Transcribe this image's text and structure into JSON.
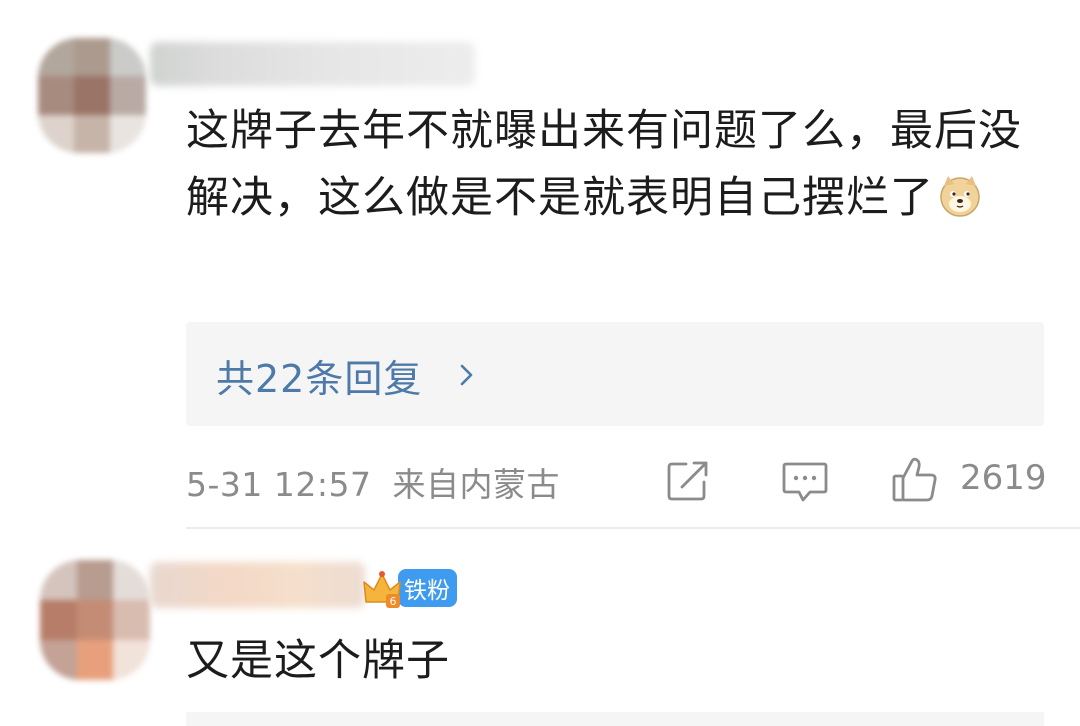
{
  "comments": [
    {
      "text": "这牌子去年不就曝出来有问题了么，最后没解决，这么做是不是就表明自己摆烂了",
      "emoji": "doge-icon",
      "replies_label": "共22条回复",
      "date": "5-31 12:57",
      "location": "来自内蒙古",
      "likes": "2619"
    },
    {
      "badge_level": "6",
      "badge_label": "铁粉",
      "text": "又是这个牌子"
    }
  ],
  "colors": {
    "link": "#4d7aa8",
    "meta": "#8b8b8b",
    "badge": "#3e9bef"
  }
}
